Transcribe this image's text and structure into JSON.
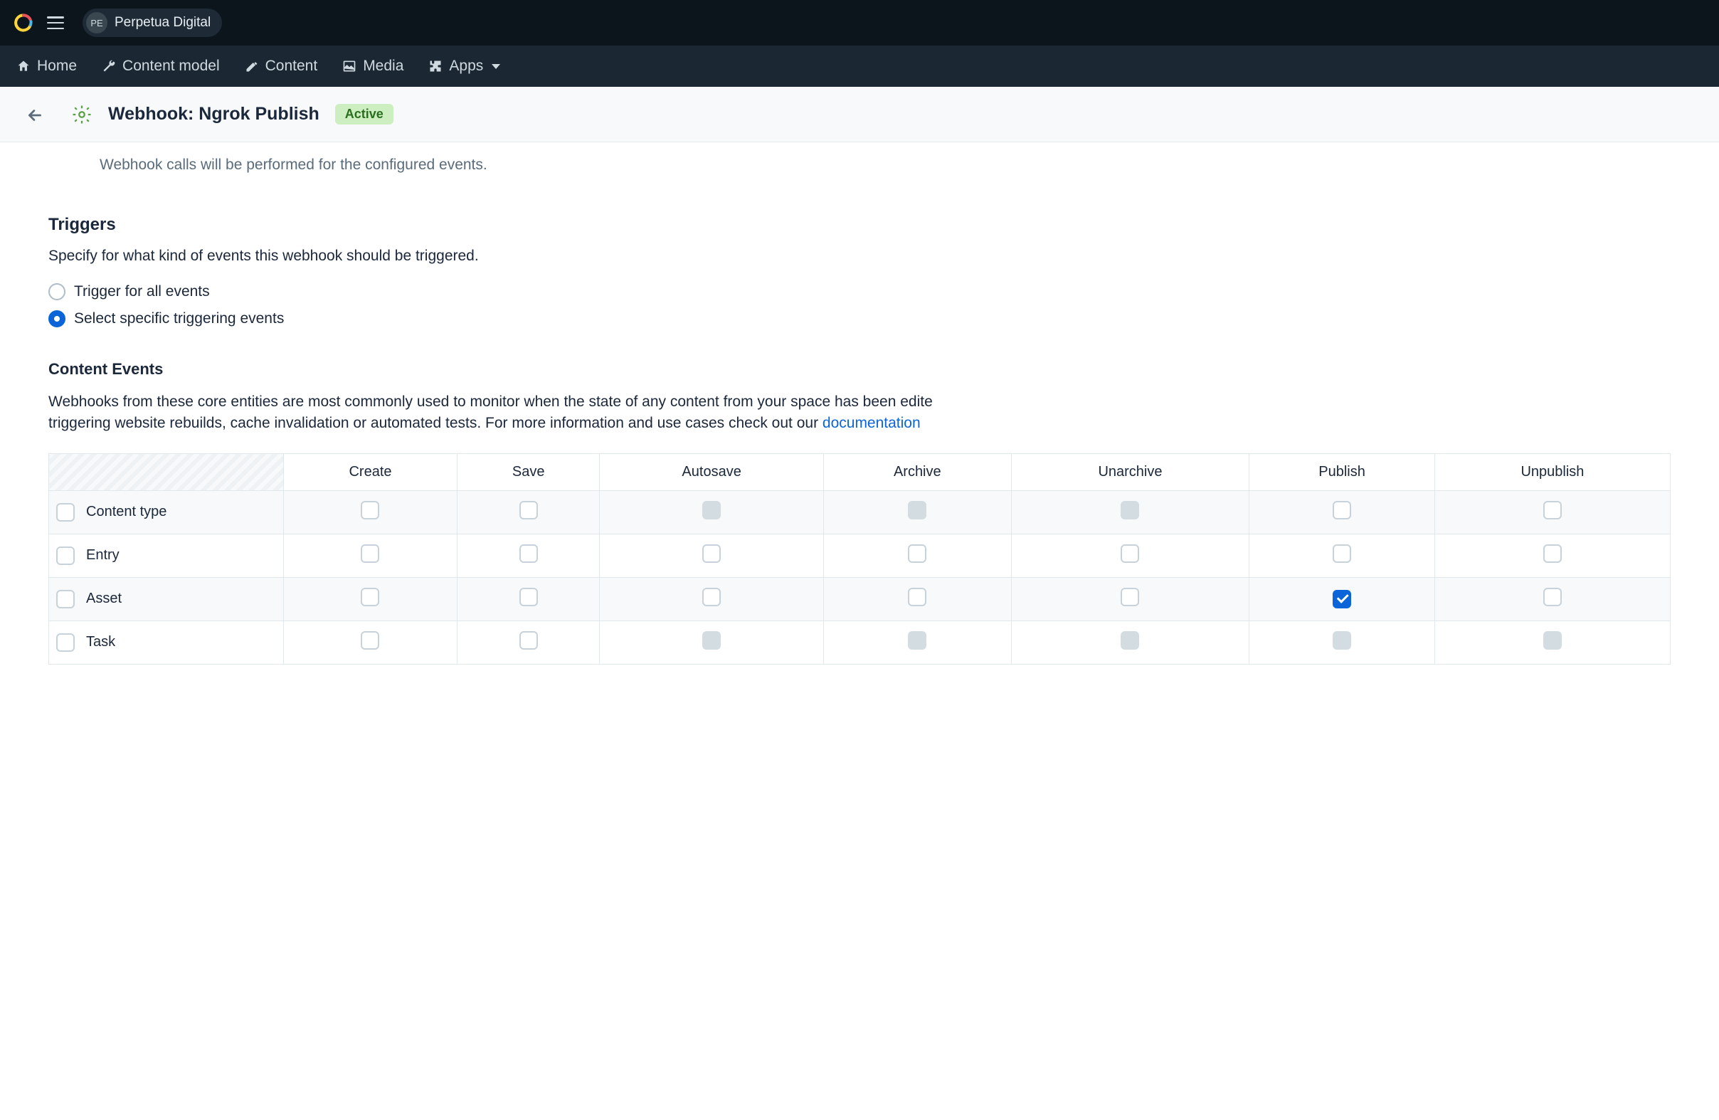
{
  "topbar": {
    "space_initials": "PE",
    "space_name": "Perpetua Digital"
  },
  "nav": {
    "home": "Home",
    "content_model": "Content model",
    "content": "Content",
    "media": "Media",
    "apps": "Apps"
  },
  "header": {
    "title": "Webhook: Ngrok Publish",
    "badge": "Active"
  },
  "body": {
    "subtext_top": "Webhook calls will be performed for the configured events.",
    "triggers_title": "Triggers",
    "triggers_desc": "Specify for what kind of events this webhook should be triggered.",
    "radio_all": "Trigger for all events",
    "radio_specific": "Select specific triggering events",
    "content_events_title": "Content Events",
    "content_events_desc_a": "Webhooks from these core entities are most commonly used to monitor when the state of any content from your space has been edite",
    "content_events_desc_b": "triggering website rebuilds, cache invalidation or automated tests. For more information and use cases check out our ",
    "doc_link": "documentation"
  },
  "table": {
    "cols": [
      "Create",
      "Save",
      "Autosave",
      "Archive",
      "Unarchive",
      "Publish",
      "Unpublish"
    ],
    "rows": [
      {
        "label": "Content type",
        "cells": [
          "unchecked",
          "unchecked",
          "disabled",
          "disabled",
          "disabled",
          "unchecked",
          "unchecked"
        ]
      },
      {
        "label": "Entry",
        "cells": [
          "unchecked",
          "unchecked",
          "unchecked",
          "unchecked",
          "unchecked",
          "unchecked",
          "unchecked"
        ]
      },
      {
        "label": "Asset",
        "cells": [
          "unchecked",
          "unchecked",
          "unchecked",
          "unchecked",
          "unchecked",
          "checked",
          "unchecked"
        ]
      },
      {
        "label": "Task",
        "cells": [
          "unchecked",
          "unchecked",
          "disabled",
          "disabled",
          "disabled",
          "disabled",
          "disabled"
        ]
      }
    ]
  }
}
